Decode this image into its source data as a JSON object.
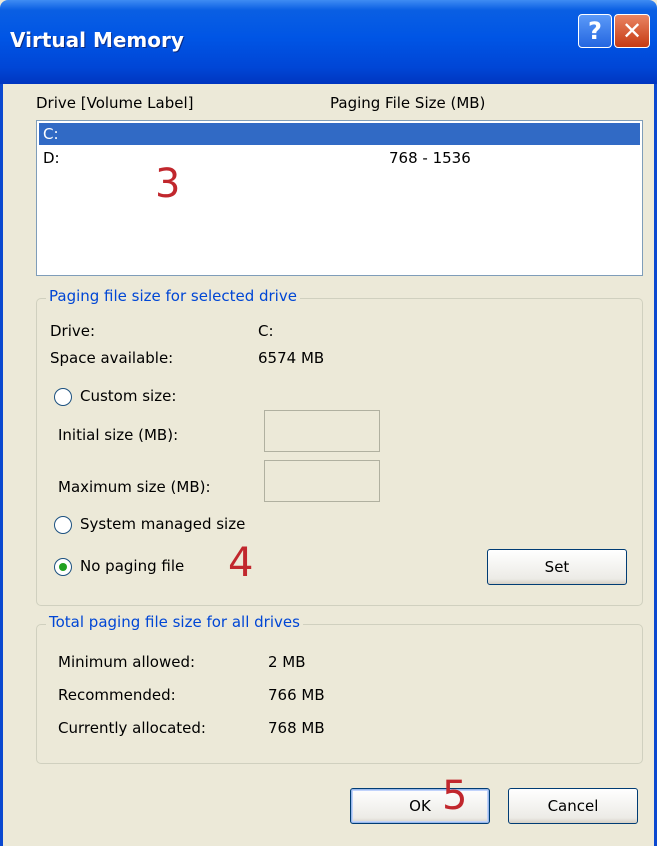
{
  "window": {
    "title": "Virtual Memory",
    "help_glyph": "?",
    "close_glyph": "✕"
  },
  "drive_list": {
    "header_drive": "Drive  [Volume Label]",
    "header_size": "Paging File Size (MB)",
    "rows": [
      {
        "drive": "C:",
        "size": "",
        "selected": true
      },
      {
        "drive": "D:",
        "size": "768 - 1536",
        "selected": false
      }
    ]
  },
  "selected_drive": {
    "legend": "Paging file size for selected drive",
    "drive_label": "Drive:",
    "drive_value": "C:",
    "space_label": "Space available:",
    "space_value": "6574 MB",
    "custom_size_label": "Custom size:",
    "initial_label": "Initial size (MB):",
    "initial_value": "",
    "maximum_label": "Maximum size (MB):",
    "maximum_value": "",
    "system_managed_label": "System managed size",
    "no_paging_label": "No paging file",
    "selected_option": "no_paging",
    "set_button": "Set"
  },
  "totals": {
    "legend": "Total paging file size for all drives",
    "min_label": "Minimum allowed:",
    "min_value": "2 MB",
    "rec_label": "Recommended:",
    "rec_value": "766 MB",
    "cur_label": "Currently allocated:",
    "cur_value": "768 MB"
  },
  "buttons": {
    "ok": "OK",
    "cancel": "Cancel"
  },
  "annotations": {
    "three": "3",
    "four": "4",
    "five": "5"
  },
  "colors": {
    "title_bar": "#0055e5",
    "selection": "#316ac5",
    "group_legend": "#0046d5",
    "annotation": "#c1272d",
    "radio_dot": "#21a121"
  }
}
